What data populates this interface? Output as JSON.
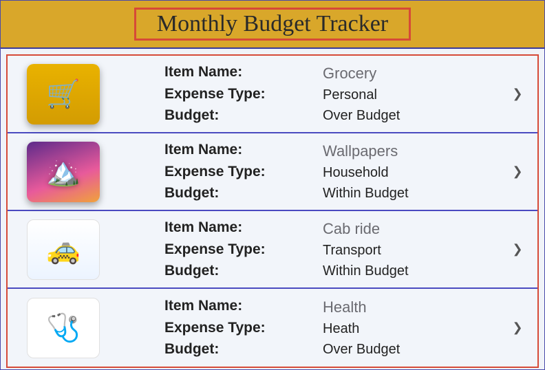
{
  "header": {
    "title": "Monthly Budget Tracker"
  },
  "labels": {
    "name": "Item Name:",
    "type": "Expense Type:",
    "budget": "Budget:"
  },
  "items": [
    {
      "icon": "grocery-icon",
      "emoji": "🛒",
      "thumbClass": "th-grocery",
      "name": "Grocery",
      "type": "Personal",
      "budget": "Over Budget"
    },
    {
      "icon": "wallpaper-icon",
      "emoji": "🏔️",
      "thumbClass": "th-wall",
      "name": "Wallpapers",
      "type": "Household",
      "budget": "Within Budget"
    },
    {
      "icon": "cab-icon",
      "emoji": "🚕",
      "thumbClass": "th-cab",
      "name": "Cab ride",
      "type": "Transport",
      "budget": "Within Budget"
    },
    {
      "icon": "health-icon",
      "emoji": "🩺",
      "thumbClass": "th-health",
      "name": "Health",
      "type": "Heath",
      "budget": "Over Budget"
    }
  ]
}
